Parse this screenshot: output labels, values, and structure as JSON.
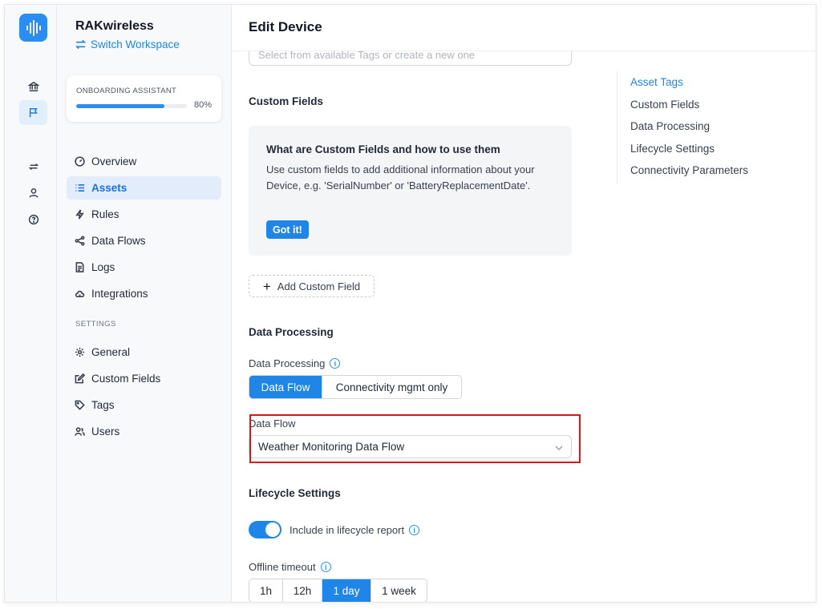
{
  "workspace": {
    "name": "RAKwireless",
    "switch_label": "Switch Workspace"
  },
  "onboarding": {
    "title": "ONBOARDING ASSISTANT",
    "progress": 80,
    "progress_label": "80%"
  },
  "nav": {
    "items": [
      {
        "label": "Overview",
        "icon": "dashboard-icon"
      },
      {
        "label": "Assets",
        "icon": "list-icon",
        "active": true
      },
      {
        "label": "Rules",
        "icon": "lightning-icon"
      },
      {
        "label": "Data Flows",
        "icon": "share-icon"
      },
      {
        "label": "Logs",
        "icon": "log-icon"
      },
      {
        "label": "Integrations",
        "icon": "cloud-icon"
      }
    ],
    "settings_header": "SETTINGS",
    "settings_items": [
      {
        "label": "General",
        "icon": "gear-icon"
      },
      {
        "label": "Custom Fields",
        "icon": "edit-icon"
      },
      {
        "label": "Tags",
        "icon": "tag-icon"
      },
      {
        "label": "Users",
        "icon": "users-icon"
      }
    ]
  },
  "page": {
    "title": "Edit Device"
  },
  "asset_tags": {
    "placeholder": "Select from available Tags or create a new one"
  },
  "custom_fields": {
    "title": "Custom Fields",
    "info_title": "What are Custom Fields and how to use them",
    "info_text": "Use custom fields to add additional information about your Device, e.g. 'SerialNumber' or 'BatteryReplacementDate'.",
    "got_it": "Got it!",
    "add_button": "Add Custom Field"
  },
  "data_processing": {
    "title": "Data Processing",
    "label": "Data Processing",
    "options": [
      "Data Flow",
      "Connectivity mgmt only"
    ],
    "selected": "Data Flow",
    "flow_label": "Data Flow",
    "flow_value": "Weather Monitoring Data Flow"
  },
  "lifecycle": {
    "title": "Lifecycle Settings",
    "include_label": "Include in lifecycle report",
    "include_enabled": true,
    "offline_label": "Offline timeout",
    "timeouts": [
      "1h",
      "12h",
      "1 day",
      "1 week"
    ],
    "selected_timeout": "1 day"
  },
  "anchor_nav": {
    "items": [
      "Asset Tags",
      "Custom Fields",
      "Data Processing",
      "Lifecycle Settings",
      "Connectivity Parameters"
    ],
    "active": "Asset Tags"
  },
  "colors": {
    "accent": "#1f86e8",
    "highlight": "#d21a1a"
  }
}
